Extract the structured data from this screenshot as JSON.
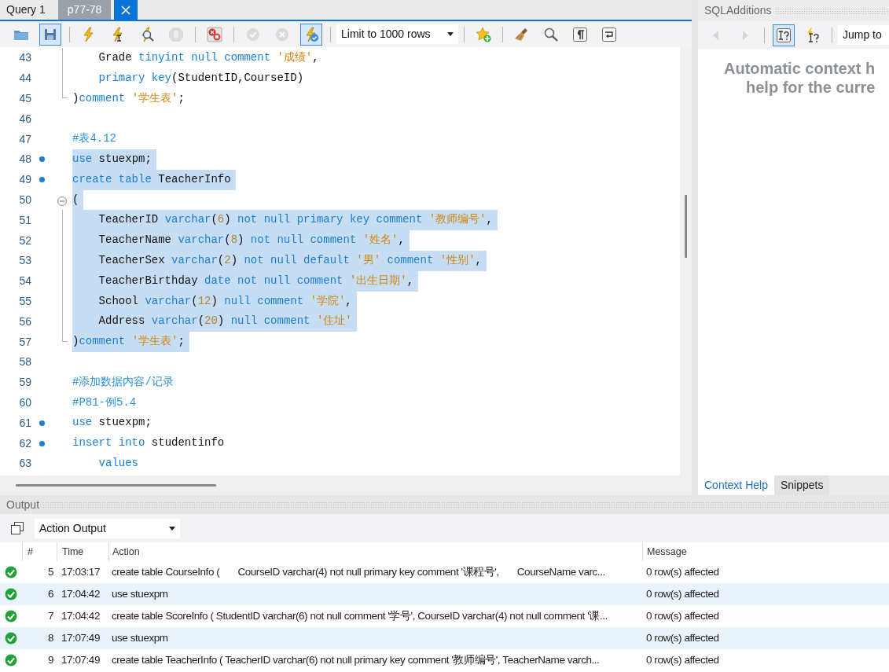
{
  "editor_tabs": [
    {
      "label": "Query 1",
      "selected": false,
      "closable": false
    },
    {
      "label": "p77-78",
      "selected": true,
      "closable": true
    }
  ],
  "toolbar": [
    [
      {
        "kind": "open",
        "pressed": false,
        "disabled": false
      },
      {
        "kind": "save",
        "pressed": true,
        "disabled": false
      }
    ],
    [
      {
        "kind": "execute",
        "pressed": false,
        "disabled": false
      },
      {
        "kind": "execute_current",
        "pressed": false,
        "disabled": false
      },
      {
        "kind": "explain",
        "pressed": false,
        "disabled": false
      },
      {
        "kind": "stop",
        "pressed": false,
        "disabled": true
      }
    ],
    [
      {
        "kind": "stop_on_error",
        "pressed": false,
        "disabled": false
      }
    ],
    [
      {
        "kind": "commit",
        "pressed": false,
        "disabled": true
      },
      {
        "kind": "rollback",
        "pressed": false,
        "disabled": true
      },
      {
        "kind": "autocommit",
        "pressed": true,
        "disabled": false
      }
    ],
    [
      {
        "kind": "select",
        "value": "Limit to 1000 rows",
        "pressed": false,
        "disabled": false
      }
    ],
    [
      {
        "kind": "bookmark",
        "pressed": false,
        "disabled": false
      }
    ],
    [
      {
        "kind": "beautify",
        "pressed": false,
        "disabled": false
      },
      {
        "kind": "find",
        "pressed": false,
        "disabled": false
      },
      {
        "kind": "invisibles",
        "pressed": false,
        "disabled": false
      },
      {
        "kind": "wrap",
        "pressed": false,
        "disabled": false
      }
    ]
  ],
  "lines": [
    {
      "number": "43",
      "marker": false,
      "selected": false,
      "fold_toggle": false,
      "fold_guide": true,
      "fold_end": false,
      "tokens": [
        {
          "kind": "plain",
          "text": "    Grade "
        },
        {
          "kind": "keyword",
          "text": "tinyint null comment "
        },
        {
          "kind": "string",
          "text": "'成绩'"
        },
        {
          "kind": "plain",
          "text": ","
        }
      ]
    },
    {
      "number": "44",
      "marker": false,
      "selected": false,
      "fold_toggle": false,
      "fold_guide": true,
      "fold_end": false,
      "tokens": [
        {
          "kind": "keyword",
          "text": "    primary key"
        },
        {
          "kind": "plain",
          "text": "(StudentID,CourseID)"
        }
      ]
    },
    {
      "number": "45",
      "marker": false,
      "selected": false,
      "fold_toggle": false,
      "fold_guide": true,
      "fold_end": true,
      "tokens": [
        {
          "kind": "plain",
          "text": ")"
        },
        {
          "kind": "keyword",
          "text": "comment "
        },
        {
          "kind": "string",
          "text": "'学生表'"
        },
        {
          "kind": "plain",
          "text": ";"
        }
      ]
    },
    {
      "number": "46",
      "marker": false,
      "selected": false,
      "fold_toggle": false,
      "fold_guide": false,
      "fold_end": false
    },
    {
      "number": "47",
      "marker": false,
      "selected": false,
      "fold_toggle": false,
      "fold_guide": false,
      "fold_end": false,
      "tokens": [
        {
          "kind": "comment",
          "text": "#表4.12"
        }
      ]
    },
    {
      "number": "48",
      "marker": true,
      "selected": true,
      "fold_toggle": false,
      "fold_guide": false,
      "fold_end": false,
      "tokens": [
        {
          "kind": "keyword",
          "text": "use"
        },
        {
          "kind": "plain",
          "text": " stuexpm;"
        }
      ]
    },
    {
      "number": "49",
      "marker": true,
      "selected": true,
      "fold_toggle": false,
      "fold_guide": false,
      "fold_end": false,
      "tokens": [
        {
          "kind": "keyword",
          "text": "create table"
        },
        {
          "kind": "plain",
          "text": " TeacherInfo"
        }
      ]
    },
    {
      "number": "50",
      "marker": false,
      "selected": true,
      "fold_toggle": true,
      "fold_guide": false,
      "fold_end": false,
      "tokens": [
        {
          "kind": "plain",
          "text": "("
        }
      ]
    },
    {
      "number": "51",
      "marker": false,
      "selected": true,
      "fold_toggle": false,
      "fold_guide": true,
      "fold_end": false,
      "tokens": [
        {
          "kind": "plain",
          "text": "    TeacherID "
        },
        {
          "kind": "keyword",
          "text": "varchar"
        },
        {
          "kind": "plain",
          "text": "("
        },
        {
          "kind": "number",
          "text": "6"
        },
        {
          "kind": "plain",
          "text": ") "
        },
        {
          "kind": "keyword",
          "text": "not null primary key comment "
        },
        {
          "kind": "string",
          "text": "'教师编号'"
        },
        {
          "kind": "plain",
          "text": ","
        }
      ]
    },
    {
      "number": "52",
      "marker": false,
      "selected": true,
      "fold_toggle": false,
      "fold_guide": true,
      "fold_end": false,
      "tokens": [
        {
          "kind": "plain",
          "text": "    TeacherName "
        },
        {
          "kind": "keyword",
          "text": "varchar"
        },
        {
          "kind": "plain",
          "text": "("
        },
        {
          "kind": "number",
          "text": "8"
        },
        {
          "kind": "plain",
          "text": ") "
        },
        {
          "kind": "keyword",
          "text": "not null comment "
        },
        {
          "kind": "string",
          "text": "'姓名'"
        },
        {
          "kind": "plain",
          "text": ","
        }
      ]
    },
    {
      "number": "53",
      "marker": false,
      "selected": true,
      "fold_toggle": false,
      "fold_guide": true,
      "fold_end": false,
      "tokens": [
        {
          "kind": "plain",
          "text": "    TeacherSex "
        },
        {
          "kind": "keyword",
          "text": "varchar"
        },
        {
          "kind": "plain",
          "text": "("
        },
        {
          "kind": "number",
          "text": "2"
        },
        {
          "kind": "plain",
          "text": ") "
        },
        {
          "kind": "keyword",
          "text": "not null default "
        },
        {
          "kind": "string",
          "text": "'男' "
        },
        {
          "kind": "keyword",
          "text": "comment "
        },
        {
          "kind": "string",
          "text": "'性别'"
        },
        {
          "kind": "plain",
          "text": ","
        }
      ]
    },
    {
      "number": "54",
      "marker": false,
      "selected": true,
      "fold_toggle": false,
      "fold_guide": true,
      "fold_end": false,
      "tokens": [
        {
          "kind": "plain",
          "text": "    TeacherBirthday "
        },
        {
          "kind": "keyword",
          "text": "date not null comment "
        },
        {
          "kind": "string",
          "text": "'出生日期'"
        },
        {
          "kind": "plain",
          "text": ","
        }
      ]
    },
    {
      "number": "55",
      "marker": false,
      "selected": true,
      "fold_toggle": false,
      "fold_guide": true,
      "fold_end": false,
      "tokens": [
        {
          "kind": "plain",
          "text": "    School "
        },
        {
          "kind": "keyword",
          "text": "varchar"
        },
        {
          "kind": "plain",
          "text": "("
        },
        {
          "kind": "number",
          "text": "12"
        },
        {
          "kind": "plain",
          "text": ") "
        },
        {
          "kind": "keyword",
          "text": "null comment "
        },
        {
          "kind": "string",
          "text": "'学院'"
        },
        {
          "kind": "plain",
          "text": ","
        }
      ]
    },
    {
      "number": "56",
      "marker": false,
      "selected": true,
      "fold_toggle": false,
      "fold_guide": true,
      "fold_end": false,
      "tokens": [
        {
          "kind": "plain",
          "text": "    Address "
        },
        {
          "kind": "keyword",
          "text": "varchar"
        },
        {
          "kind": "plain",
          "text": "("
        },
        {
          "kind": "number",
          "text": "20"
        },
        {
          "kind": "plain",
          "text": ") "
        },
        {
          "kind": "keyword",
          "text": "null comment "
        },
        {
          "kind": "string",
          "text": "'住址'"
        }
      ]
    },
    {
      "number": "57",
      "marker": false,
      "selected": true,
      "fold_toggle": false,
      "fold_guide": true,
      "fold_end": true,
      "tokens": [
        {
          "kind": "plain",
          "text": ")"
        },
        {
          "kind": "keyword",
          "text": "comment "
        },
        {
          "kind": "string",
          "text": "'学生表'"
        },
        {
          "kind": "plain",
          "text": ";"
        }
      ]
    },
    {
      "number": "58",
      "marker": false,
      "selected": false,
      "fold_toggle": false,
      "fold_guide": false,
      "fold_end": false
    },
    {
      "number": "59",
      "marker": false,
      "selected": false,
      "fold_toggle": false,
      "fold_guide": false,
      "fold_end": false,
      "tokens": [
        {
          "kind": "comment",
          "text": "#添加数据内容/记录"
        }
      ]
    },
    {
      "number": "60",
      "marker": false,
      "selected": false,
      "fold_toggle": false,
      "fold_guide": false,
      "fold_end": false,
      "tokens": [
        {
          "kind": "comment",
          "text": "#P81-例5.4"
        }
      ]
    },
    {
      "number": "61",
      "marker": true,
      "selected": false,
      "fold_toggle": false,
      "fold_guide": false,
      "fold_end": false,
      "tokens": [
        {
          "kind": "keyword",
          "text": "use"
        },
        {
          "kind": "plain",
          "text": " stuexpm;"
        }
      ]
    },
    {
      "number": "62",
      "marker": true,
      "selected": false,
      "fold_toggle": false,
      "fold_guide": false,
      "fold_end": false,
      "tokens": [
        {
          "kind": "keyword",
          "text": "insert into"
        },
        {
          "kind": "plain",
          "text": " studentinfo"
        }
      ]
    },
    {
      "number": "63",
      "marker": false,
      "selected": false,
      "fold_toggle": false,
      "fold_guide": false,
      "fold_end": false,
      "tokens": [
        {
          "kind": "keyword",
          "text": "    values"
        }
      ]
    }
  ],
  "sql_additions": {
    "title": "SQLAdditions",
    "toolbar": [
      [
        {
          "kind": "back",
          "pressed": false,
          "disabled": true
        },
        {
          "kind": "forward",
          "pressed": false,
          "disabled": true
        }
      ],
      [
        {
          "kind": "manual_help",
          "pressed": true,
          "disabled": false
        },
        {
          "kind": "auto_help",
          "pressed": false,
          "disabled": false
        }
      ]
    ],
    "jump_to": "Jump to",
    "help_lines": [
      "Automatic context h",
      "help for the curre"
    ],
    "tabs": [
      {
        "label": "Context Help",
        "selected": true
      },
      {
        "label": "Snippets",
        "selected": false
      }
    ]
  },
  "output": {
    "title": "Output",
    "view": "Action Output",
    "columns": [
      "#",
      "Time",
      "Action",
      "Message"
    ],
    "rows": [
      {
        "ok": true,
        "number": "5",
        "time": "17:03:17",
        "action": "create table CourseInfo (       CourseID varchar(4) not null primary key comment '课程号',       CourseName varc...",
        "message": "0 row(s) affected"
      },
      {
        "ok": true,
        "number": "6",
        "time": "17:04:42",
        "action": "use stuexpm",
        "message": "0 row(s) affected"
      },
      {
        "ok": true,
        "number": "7",
        "time": "17:04:42",
        "action": "create table ScoreInfo ( StudentID varchar(6) not null comment '学号', CourseID varchar(4) not null comment '课...",
        "message": "0 row(s) affected"
      },
      {
        "ok": true,
        "number": "8",
        "time": "17:07:49",
        "action": "use stuexpm",
        "message": "0 row(s) affected"
      },
      {
        "ok": true,
        "number": "9",
        "time": "17:07:49",
        "action": "create table TeacherInfo ( TeacherID varchar(6) not null primary key comment '教师编号', TeacherName varch...",
        "message": "0 row(s) affected"
      }
    ]
  }
}
